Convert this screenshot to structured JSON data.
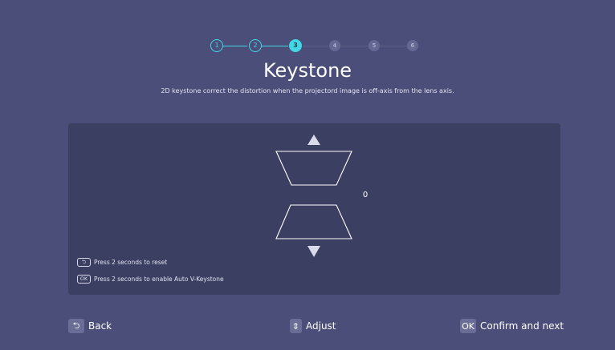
{
  "steps": {
    "items": [
      {
        "label": "1",
        "state": "done"
      },
      {
        "label": "2",
        "state": "done"
      },
      {
        "label": "3",
        "state": "active"
      },
      {
        "label": "4",
        "state": "todo"
      },
      {
        "label": "5",
        "state": "todo"
      },
      {
        "label": "6",
        "state": "todo"
      }
    ]
  },
  "page": {
    "title": "Keystone",
    "description": "2D keystone correct the distortion when the projectord image is off-axis from the lens axis."
  },
  "keystone": {
    "value": "0"
  },
  "hints": {
    "reset_key": "⮌",
    "reset_text": "Press 2 seconds to reset",
    "ok_key": "OK",
    "auto_text": "Press 2 seconds to enable Auto V-Keystone"
  },
  "footer": {
    "back_icon": "⮌",
    "back_label": "Back",
    "adjust_icon": "⇕",
    "adjust_label": "Adjust",
    "confirm_key": "OK",
    "confirm_label": "Confirm and next"
  },
  "colors": {
    "background": "#4a4e78",
    "panel": "#3b3f62",
    "accent": "#43d7e6",
    "step_todo": "#646893"
  }
}
